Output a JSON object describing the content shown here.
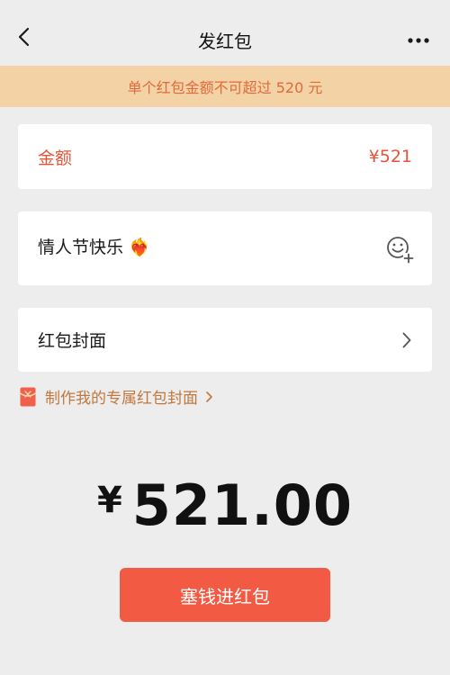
{
  "nav": {
    "title": "发红包"
  },
  "notice": {
    "text": "单个红包金额不可超过 520 元"
  },
  "amount": {
    "label": "金额",
    "value": "¥521"
  },
  "message": {
    "text": "情人节快乐 ❤️‍🔥"
  },
  "cover": {
    "label": "红包封面"
  },
  "custom_cover_link": {
    "text": "制作我的专属红包封面"
  },
  "total": {
    "currency": "¥",
    "amount": "521.00"
  },
  "submit": {
    "label": "塞钱进红包"
  },
  "colors": {
    "accent": "#f25a44",
    "notice_bg": "#f3d3a6",
    "notice_text": "#e06a3c",
    "amount_text": "#e5553a",
    "link_text": "#c0773f",
    "page_bg": "#ededed"
  },
  "icons": {
    "back": "chevron-left-icon",
    "more": "more-dots-icon",
    "emoji": "emoji-add-icon",
    "cover_arrow": "chevron-right-icon",
    "custom_cover": "red-envelope-icon"
  }
}
